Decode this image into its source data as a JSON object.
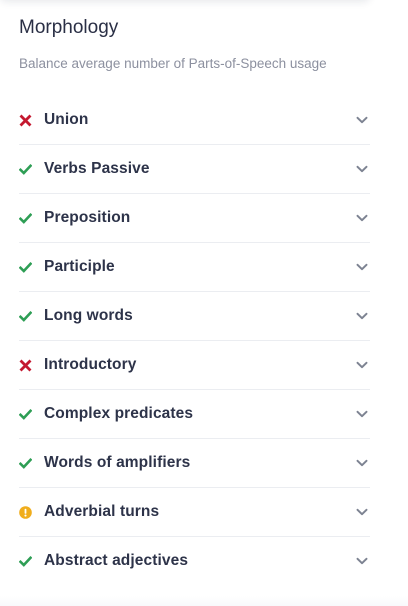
{
  "section": {
    "title": "Morphology",
    "subtitle": "Balance average number of Parts-of-Speech usage"
  },
  "colors": {
    "pass": "#2e9e55",
    "fail": "#c4182f",
    "warning": "#f0ad1c",
    "chevron": "#7d8392"
  },
  "items": [
    {
      "label": "Union",
      "status": "fail",
      "icon": "cross-icon"
    },
    {
      "label": "Verbs Passive",
      "status": "pass",
      "icon": "check-icon"
    },
    {
      "label": "Preposition",
      "status": "pass",
      "icon": "check-icon"
    },
    {
      "label": "Participle",
      "status": "pass",
      "icon": "check-icon"
    },
    {
      "label": "Long words",
      "status": "pass",
      "icon": "check-icon"
    },
    {
      "label": "Introductory",
      "status": "fail",
      "icon": "cross-icon"
    },
    {
      "label": "Complex predicates",
      "status": "pass",
      "icon": "check-icon"
    },
    {
      "label": "Words of amplifiers",
      "status": "pass",
      "icon": "check-icon"
    },
    {
      "label": "Adverbial turns",
      "status": "warning",
      "icon": "warning-icon"
    },
    {
      "label": "Abstract adjectives",
      "status": "pass",
      "icon": "check-icon"
    }
  ]
}
